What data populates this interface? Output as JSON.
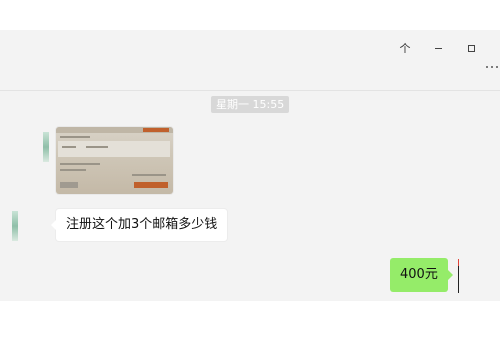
{
  "window": {
    "pin_icon": "pin-icon",
    "minimize_icon": "minimize-icon",
    "maximize_icon": "maximize-icon",
    "more_icon": "more-options-icon"
  },
  "chat": {
    "timestamp": "星期一 15:55",
    "messages": [
      {
        "type": "image",
        "direction": "received"
      },
      {
        "type": "text",
        "direction": "received",
        "text": "注册这个加3个邮箱多少钱"
      },
      {
        "type": "text",
        "direction": "sent",
        "text": "400元"
      }
    ]
  },
  "colors": {
    "sent_bubble": "#95ec69",
    "received_bubble": "#ffffff",
    "chat_background": "#f3f3f3",
    "timestamp_badge": "#d8d8d8"
  }
}
